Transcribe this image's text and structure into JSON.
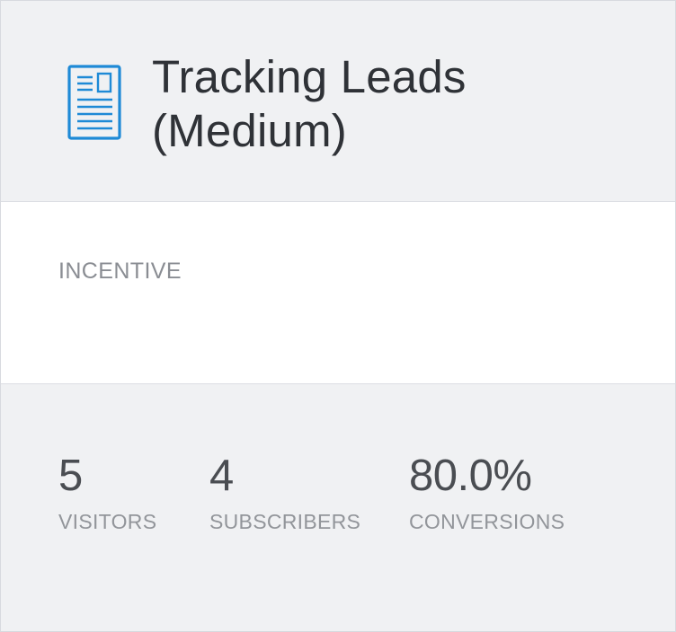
{
  "card": {
    "icon": "document-icon",
    "title_line1": "Tracking Leads",
    "title_line2": "(Medium)",
    "accent_color": "#1e8ad6"
  },
  "incentive": {
    "label": "INCENTIVE"
  },
  "stats": {
    "visitors": {
      "value": "5",
      "label": "VISITORS"
    },
    "subscribers": {
      "value": "4",
      "label": "SUBSCRIBERS"
    },
    "conversions": {
      "value": "80.0%",
      "label": "CONVERSIONS"
    }
  }
}
